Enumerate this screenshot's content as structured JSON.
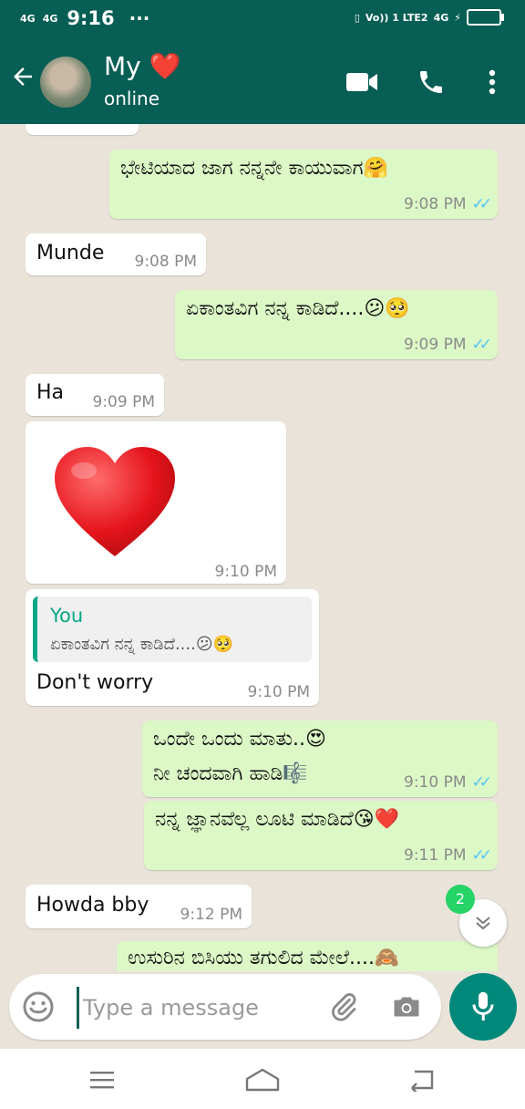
{
  "status_bar": {
    "network_1": "4G",
    "network_2": "4G",
    "time": "9:16",
    "dots": "···",
    "volte": "Vo)) 1 LTE2",
    "network_3": "4G"
  },
  "header": {
    "back_icon": "arrow-left-icon",
    "contact_name": "My",
    "name_emoji": "❤️",
    "status": "online",
    "video_icon": "video-camera-icon",
    "call_icon": "phone-icon",
    "menu_icon": "more-vertical-icon"
  },
  "messages": [
    {
      "direction": "out",
      "text": "ಭೇಟಿಯಾದ ಜಾಗ ನನ್ನನೇ ಕಾಯುವಾಗ🤗",
      "time": "9:08 PM",
      "status": "read"
    },
    {
      "direction": "in",
      "text": "Munde",
      "time": "9:08 PM"
    },
    {
      "direction": "out",
      "text": "ಏಕಾಂತವಿಗ ನನ್ನ ಕಾಡಿದೆ....😕🥺",
      "time": "9:09 PM",
      "status": "read"
    },
    {
      "direction": "in",
      "text": "Ha",
      "time": "9:09 PM"
    },
    {
      "direction": "in",
      "text": "❤️",
      "time": "9:10 PM"
    },
    {
      "direction": "in",
      "reply_author": "You",
      "reply_text": "ಏಕಾಂತವಿಗ ನನ್ನ ಕಾಡಿದೆ....😕🥺",
      "text": "Don't worry",
      "time": "9:10 PM"
    },
    {
      "direction": "out",
      "text_line1": "ಒಂದೇ ಒಂದು ಮಾತು..😍",
      "text_line2": "ನೀ ಚಂದವಾಗಿ ಹಾಡಿ🎼",
      "time": "9:10 PM",
      "status": "read"
    },
    {
      "direction": "out",
      "text": "ನನ್ನ ಜ್ಞಾನವೆಲ್ಲ ಲೂಟಿ ಮಾಡಿದೆ😘❤️",
      "time": "9:11 PM",
      "status": "read"
    },
    {
      "direction": "in",
      "text": "Howda bby",
      "time": "9:12 PM"
    },
    {
      "direction": "out",
      "text": "ಉಸುರಿನ ಬಿಸಿಯು ತಗುಲಿದ ಮೇಲೆ....🙈"
    }
  ],
  "ticks": "✓✓",
  "unread_count": "2",
  "composer": {
    "placeholder": "Type a message",
    "emoji_icon": "emoji-icon",
    "attach_icon": "paperclip-icon",
    "camera_icon": "camera-icon",
    "mic_icon": "microphone-icon"
  },
  "nav_bar": {
    "menu_icon": "menu-icon",
    "home_icon": "home-icon",
    "back_icon": "back-icon"
  },
  "colors": {
    "header": "#075e54",
    "outgoing_bubble": "#dcf8c6",
    "incoming_bubble": "#ffffff",
    "read_ticks": "#4fc3f7",
    "mic_button": "#00897b",
    "unread_badge": "#25d366"
  }
}
